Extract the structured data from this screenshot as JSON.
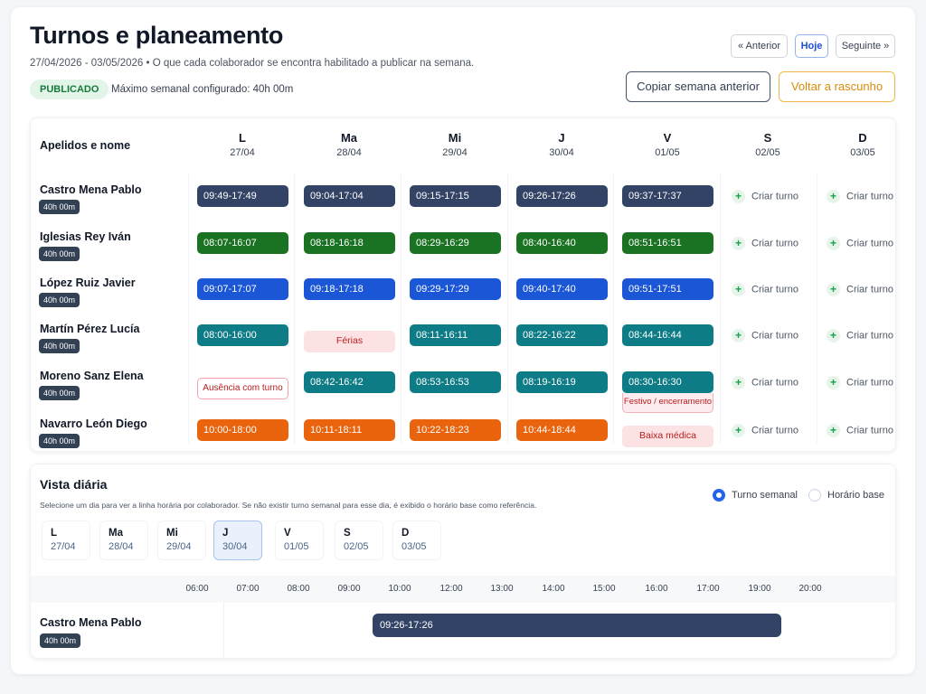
{
  "header": {
    "title": "Turnos e planeamento",
    "subtitle": "27/04/2026 - 03/05/2026  •  O que cada colaborador se encontra habilitado a publicar na semana.",
    "status_badge": "PUBLICADO",
    "max_week": "Máximo semanal configurado: 40h 00m",
    "nav": {
      "prev": "« Anterior",
      "today": "Hoje",
      "next": "Seguinte »"
    },
    "copy_prev_week": "Copiar semana anterior",
    "back_to_draft": "Voltar a rascunho"
  },
  "grid": {
    "name_header": "Apelidos e nome",
    "days": [
      {
        "label": "L",
        "date": "27/04"
      },
      {
        "label": "Ma",
        "date": "28/04"
      },
      {
        "label": "Mi",
        "date": "29/04"
      },
      {
        "label": "J",
        "date": "30/04"
      },
      {
        "label": "V",
        "date": "01/05"
      },
      {
        "label": "S",
        "date": "02/05"
      },
      {
        "label": "D",
        "date": "03/05"
      }
    ],
    "create_label": "Criar turno",
    "employees": [
      {
        "name": "Castro Mena Pablo",
        "hours": "40h 00m",
        "cells": [
          {
            "type": "shift",
            "text": "09:49-17:49",
            "color": "navy"
          },
          {
            "type": "shift",
            "text": "09:04-17:04",
            "color": "navy"
          },
          {
            "type": "shift",
            "text": "09:15-17:15",
            "color": "navy"
          },
          {
            "type": "shift",
            "text": "09:26-17:26",
            "color": "navy"
          },
          {
            "type": "shift",
            "text": "09:37-17:37",
            "color": "navy"
          }
        ]
      },
      {
        "name": "Iglesias Rey Iván",
        "hours": "40h 00m",
        "cells": [
          {
            "type": "shift",
            "text": "08:07-16:07",
            "color": "green"
          },
          {
            "type": "shift",
            "text": "08:18-16:18",
            "color": "green"
          },
          {
            "type": "shift",
            "text": "08:29-16:29",
            "color": "green"
          },
          {
            "type": "shift",
            "text": "08:40-16:40",
            "color": "green"
          },
          {
            "type": "shift",
            "text": "08:51-16:51",
            "color": "green"
          }
        ]
      },
      {
        "name": "López Ruiz Javier",
        "hours": "40h 00m",
        "cells": [
          {
            "type": "shift",
            "text": "09:07-17:07",
            "color": "blue"
          },
          {
            "type": "shift",
            "text": "09:18-17:18",
            "color": "blue"
          },
          {
            "type": "shift",
            "text": "09:29-17:29",
            "color": "blue"
          },
          {
            "type": "shift",
            "text": "09:40-17:40",
            "color": "blue"
          },
          {
            "type": "shift",
            "text": "09:51-17:51",
            "color": "blue"
          }
        ]
      },
      {
        "name": "Martín Pérez Lucía",
        "hours": "40h 00m",
        "cells": [
          {
            "type": "shift",
            "text": "08:00-16:00",
            "color": "teal"
          },
          {
            "type": "absence",
            "text": "Férias",
            "style": "fill"
          },
          {
            "type": "shift",
            "text": "08:11-16:11",
            "color": "teal"
          },
          {
            "type": "shift",
            "text": "08:22-16:22",
            "color": "teal"
          },
          {
            "type": "shift",
            "text": "08:44-16:44",
            "color": "teal"
          }
        ]
      },
      {
        "name": "Moreno Sanz Elena",
        "hours": "40h 00m",
        "cells": [
          {
            "type": "absence",
            "text": "Ausência com turno",
            "style": "outline"
          },
          {
            "type": "shift",
            "text": "08:42-16:42",
            "color": "teal"
          },
          {
            "type": "shift",
            "text": "08:53-16:53",
            "color": "teal"
          },
          {
            "type": "shift",
            "text": "08:19-16:19",
            "color": "teal"
          },
          {
            "type": "shift",
            "text": "08:30-16:30",
            "color": "teal",
            "note": "Festivo / encerramento"
          }
        ]
      },
      {
        "name": "Navarro León Diego",
        "hours": "40h 00m",
        "cells": [
          {
            "type": "shift",
            "text": "10:00-18:00",
            "color": "orange"
          },
          {
            "type": "shift",
            "text": "10:11-18:11",
            "color": "orange"
          },
          {
            "type": "shift",
            "text": "10:22-18:23",
            "color": "orange"
          },
          {
            "type": "shift",
            "text": "10:44-18:44",
            "color": "orange"
          },
          {
            "type": "absence",
            "text": "Baixa médica",
            "style": "fill"
          }
        ]
      }
    ]
  },
  "daily": {
    "title": "Vista diária",
    "description": "Selecione um dia para ver a linha horária por colaborador. Se não existir turno semanal para esse dia, é exibido o horário base como referência.",
    "radio_weekly": "Turno semanal",
    "radio_base": "Horário base",
    "selected_mode": "weekly",
    "selected_day": 3,
    "hours": [
      "06:00",
      "07:00",
      "08:00",
      "09:00",
      "10:00",
      "12:00",
      "13:00",
      "14:00",
      "15:00",
      "16:00",
      "17:00",
      "19:00",
      "20:00"
    ],
    "row": {
      "name": "Castro Mena Pablo",
      "hours": "40h 00m",
      "shift": "09:26-17:26",
      "start": 9.4333,
      "end": 17.4333
    }
  },
  "colors": {
    "navy": "#334366",
    "green": "#197322",
    "blue": "#1a56d6",
    "teal": "#0e7c86",
    "orange": "#ea640d",
    "published_bg": "#e3f5e9",
    "published_fg": "#177a3a",
    "draft_accent": "#f3b54a",
    "radio_active": "#2563eb"
  }
}
